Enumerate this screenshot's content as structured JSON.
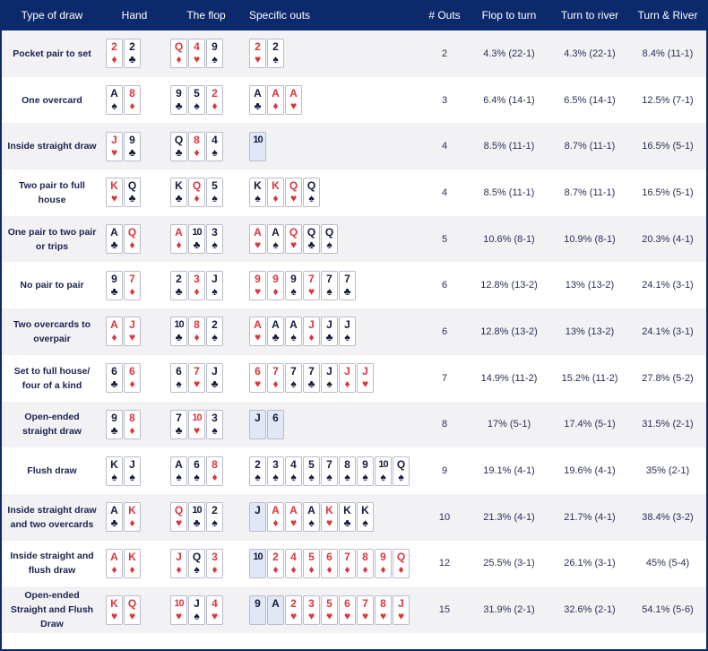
{
  "headers": {
    "type": "Type of draw",
    "hand": "Hand",
    "flop": "The flop",
    "outs": "Specific outs",
    "num_outs": "# Outs",
    "flop_turn": "Flop to turn",
    "turn_river": "Turn to river",
    "turn_and_river": "Turn & River"
  },
  "rows": [
    {
      "type": "Pocket pair to set",
      "hand": [
        {
          "r": "2",
          "s": "♦"
        },
        {
          "r": "2",
          "s": "♣"
        }
      ],
      "flop": [
        {
          "r": "Q",
          "s": "♦"
        },
        {
          "r": "4",
          "s": "♥"
        },
        {
          "r": "9",
          "s": "♠"
        }
      ],
      "outs": [
        {
          "r": "2",
          "s": "♥"
        },
        {
          "r": "2",
          "s": "♠"
        }
      ],
      "num": "2",
      "ft": "4.3% (22-1)",
      "tr": "4.3% (22-1)",
      "tnr": "8.4% (11-1)"
    },
    {
      "type": "One overcard",
      "hand": [
        {
          "r": "A",
          "s": "♠"
        },
        {
          "r": "8",
          "s": "♦"
        }
      ],
      "flop": [
        {
          "r": "9",
          "s": "♣"
        },
        {
          "r": "5",
          "s": "♠"
        },
        {
          "r": "2",
          "s": "♦"
        }
      ],
      "outs": [
        {
          "r": "A",
          "s": "♣"
        },
        {
          "r": "A",
          "s": "♦"
        },
        {
          "r": "A",
          "s": "♥"
        }
      ],
      "num": "3",
      "ft": "6.4% (14-1)",
      "tr": "6.5% (14-1)",
      "tnr": "12.5% (7-1)"
    },
    {
      "type": "Inside straight draw",
      "hand": [
        {
          "r": "J",
          "s": "♥"
        },
        {
          "r": "9",
          "s": "♣"
        }
      ],
      "flop": [
        {
          "r": "Q",
          "s": "♣"
        },
        {
          "r": "8",
          "s": "♦"
        },
        {
          "r": "4",
          "s": "♠"
        }
      ],
      "outs": [
        {
          "r": "10",
          "s": "",
          "blue": true
        }
      ],
      "num": "4",
      "ft": "8.5% (11-1)",
      "tr": "8.7% (11-1)",
      "tnr": "16.5% (5-1)"
    },
    {
      "type": "Two pair to full house",
      "hand": [
        {
          "r": "K",
          "s": "♥"
        },
        {
          "r": "Q",
          "s": "♣"
        }
      ],
      "flop": [
        {
          "r": "K",
          "s": "♣"
        },
        {
          "r": "Q",
          "s": "♦"
        },
        {
          "r": "5",
          "s": "♠"
        }
      ],
      "outs": [
        {
          "r": "K",
          "s": "♠"
        },
        {
          "r": "K",
          "s": "♦"
        },
        {
          "r": "Q",
          "s": "♥"
        },
        {
          "r": "Q",
          "s": "♠"
        }
      ],
      "num": "4",
      "ft": "8.5% (11-1)",
      "tr": "8.7% (11-1)",
      "tnr": "16.5% (5-1)"
    },
    {
      "type": "One pair to two pair or trips",
      "hand": [
        {
          "r": "A",
          "s": "♣"
        },
        {
          "r": "Q",
          "s": "♦"
        }
      ],
      "flop": [
        {
          "r": "A",
          "s": "♦"
        },
        {
          "r": "10",
          "s": "♣"
        },
        {
          "r": "3",
          "s": "♠"
        }
      ],
      "outs": [
        {
          "r": "A",
          "s": "♥"
        },
        {
          "r": "A",
          "s": "♠"
        },
        {
          "r": "Q",
          "s": "♥"
        },
        {
          "r": "Q",
          "s": "♣"
        },
        {
          "r": "Q",
          "s": "♠"
        }
      ],
      "num": "5",
      "ft": "10.6% (8-1)",
      "tr": "10.9% (8-1)",
      "tnr": "20.3% (4-1)"
    },
    {
      "type": "No pair to pair",
      "hand": [
        {
          "r": "9",
          "s": "♣"
        },
        {
          "r": "7",
          "s": "♦"
        }
      ],
      "flop": [
        {
          "r": "2",
          "s": "♣"
        },
        {
          "r": "3",
          "s": "♦"
        },
        {
          "r": "J",
          "s": "♠"
        }
      ],
      "outs": [
        {
          "r": "9",
          "s": "♥"
        },
        {
          "r": "9",
          "s": "♦"
        },
        {
          "r": "9",
          "s": "♠"
        },
        {
          "r": "7",
          "s": "♥"
        },
        {
          "r": "7",
          "s": "♠"
        },
        {
          "r": "7",
          "s": "♣"
        }
      ],
      "num": "6",
      "ft": "12.8% (13-2)",
      "tr": "13% (13-2)",
      "tnr": "24.1% (3-1)"
    },
    {
      "type": "Two overcards to overpair",
      "hand": [
        {
          "r": "A",
          "s": "♦"
        },
        {
          "r": "J",
          "s": "♥"
        }
      ],
      "flop": [
        {
          "r": "10",
          "s": "♣"
        },
        {
          "r": "8",
          "s": "♦"
        },
        {
          "r": "2",
          "s": "♠"
        }
      ],
      "outs": [
        {
          "r": "A",
          "s": "♥"
        },
        {
          "r": "A",
          "s": "♣"
        },
        {
          "r": "A",
          "s": "♠"
        },
        {
          "r": "J",
          "s": "♦"
        },
        {
          "r": "J",
          "s": "♣"
        },
        {
          "r": "J",
          "s": "♠"
        }
      ],
      "num": "6",
      "ft": "12.8% (13-2)",
      "tr": "13% (13-2)",
      "tnr": "24.1% (3-1)"
    },
    {
      "type": "Set to full house/ four of a kind",
      "hand": [
        {
          "r": "6",
          "s": "♣"
        },
        {
          "r": "6",
          "s": "♦"
        }
      ],
      "flop": [
        {
          "r": "6",
          "s": "♠"
        },
        {
          "r": "7",
          "s": "♥"
        },
        {
          "r": "J",
          "s": "♣"
        }
      ],
      "outs": [
        {
          "r": "6",
          "s": "♥"
        },
        {
          "r": "7",
          "s": "♦"
        },
        {
          "r": "7",
          "s": "♠"
        },
        {
          "r": "7",
          "s": "♣"
        },
        {
          "r": "J",
          "s": "♠"
        },
        {
          "r": "J",
          "s": "♦"
        },
        {
          "r": "J",
          "s": "♥"
        }
      ],
      "num": "7",
      "ft": "14.9% (11-2)",
      "tr": "15.2% (11-2)",
      "tnr": "27.8% (5-2)"
    },
    {
      "type": "Open-ended straight draw",
      "hand": [
        {
          "r": "9",
          "s": "♣"
        },
        {
          "r": "8",
          "s": "♦"
        }
      ],
      "flop": [
        {
          "r": "7",
          "s": "♣"
        },
        {
          "r": "10",
          "s": "♥"
        },
        {
          "r": "3",
          "s": "♠"
        }
      ],
      "outs": [
        {
          "r": "J",
          "s": "",
          "blue": true
        },
        {
          "r": "6",
          "s": "",
          "blue": true
        }
      ],
      "num": "8",
      "ft": "17% (5-1)",
      "tr": "17.4% (5-1)",
      "tnr": "31.5% (2-1)"
    },
    {
      "type": "Flush draw",
      "hand": [
        {
          "r": "K",
          "s": "♠"
        },
        {
          "r": "J",
          "s": "♠"
        }
      ],
      "flop": [
        {
          "r": "A",
          "s": "♠"
        },
        {
          "r": "6",
          "s": "♠"
        },
        {
          "r": "8",
          "s": "♦"
        }
      ],
      "outs": [
        {
          "r": "2",
          "s": "♠"
        },
        {
          "r": "3",
          "s": "♠"
        },
        {
          "r": "4",
          "s": "♠"
        },
        {
          "r": "5",
          "s": "♠"
        },
        {
          "r": "7",
          "s": "♠"
        },
        {
          "r": "8",
          "s": "♠"
        },
        {
          "r": "9",
          "s": "♠"
        },
        {
          "r": "10",
          "s": "♠"
        },
        {
          "r": "Q",
          "s": "♠"
        }
      ],
      "num": "9",
      "ft": "19.1% (4-1)",
      "tr": "19.6% (4-1)",
      "tnr": "35% (2-1)"
    },
    {
      "type": "Inside straight draw and two overcards",
      "hand": [
        {
          "r": "A",
          "s": "♣"
        },
        {
          "r": "K",
          "s": "♦"
        }
      ],
      "flop": [
        {
          "r": "Q",
          "s": "♥"
        },
        {
          "r": "10",
          "s": "♣"
        },
        {
          "r": "2",
          "s": "♠"
        }
      ],
      "outs": [
        {
          "r": "J",
          "s": "",
          "blue": true
        },
        {
          "r": "A",
          "s": "♦"
        },
        {
          "r": "A",
          "s": "♥"
        },
        {
          "r": "A",
          "s": "♠"
        },
        {
          "r": "K",
          "s": "♥"
        },
        {
          "r": "K",
          "s": "♣"
        },
        {
          "r": "K",
          "s": "♠"
        }
      ],
      "num": "10",
      "ft": "21.3% (4-1)",
      "tr": "21.7% (4-1)",
      "tnr": "38.4% (3-2)"
    },
    {
      "type": "Inside straight and flush draw",
      "hand": [
        {
          "r": "A",
          "s": "♦"
        },
        {
          "r": "K",
          "s": "♦"
        }
      ],
      "flop": [
        {
          "r": "J",
          "s": "♦"
        },
        {
          "r": "Q",
          "s": "♠"
        },
        {
          "r": "3",
          "s": "♦"
        }
      ],
      "outs": [
        {
          "r": "10",
          "s": "",
          "blue": true
        },
        {
          "r": "2",
          "s": "♦"
        },
        {
          "r": "4",
          "s": "♦"
        },
        {
          "r": "5",
          "s": "♦"
        },
        {
          "r": "6",
          "s": "♦"
        },
        {
          "r": "7",
          "s": "♦"
        },
        {
          "r": "8",
          "s": "♦"
        },
        {
          "r": "9",
          "s": "♦"
        },
        {
          "r": "Q",
          "s": "♦"
        }
      ],
      "num": "12",
      "ft": "25.5% (3-1)",
      "tr": "26.1% (3-1)",
      "tnr": "45% (5-4)"
    },
    {
      "type": "Open-ended Straight and Flush Draw",
      "hand": [
        {
          "r": "K",
          "s": "♥"
        },
        {
          "r": "Q",
          "s": "♥"
        }
      ],
      "flop": [
        {
          "r": "10",
          "s": "♥"
        },
        {
          "r": "J",
          "s": "♠"
        },
        {
          "r": "4",
          "s": "♥"
        }
      ],
      "outs": [
        {
          "r": "9",
          "s": "",
          "blue": true
        },
        {
          "r": "A",
          "s": "",
          "blue": true
        },
        {
          "r": "2",
          "s": "♥"
        },
        {
          "r": "3",
          "s": "♥"
        },
        {
          "r": "5",
          "s": "♥"
        },
        {
          "r": "6",
          "s": "♥"
        },
        {
          "r": "7",
          "s": "♥"
        },
        {
          "r": "8",
          "s": "♥"
        },
        {
          "r": "J",
          "s": "♥"
        }
      ],
      "num": "15",
      "ft": "31.9% (2-1)",
      "tr": "32.6% (2-1)",
      "tnr": "54.1% (5-6)"
    }
  ]
}
